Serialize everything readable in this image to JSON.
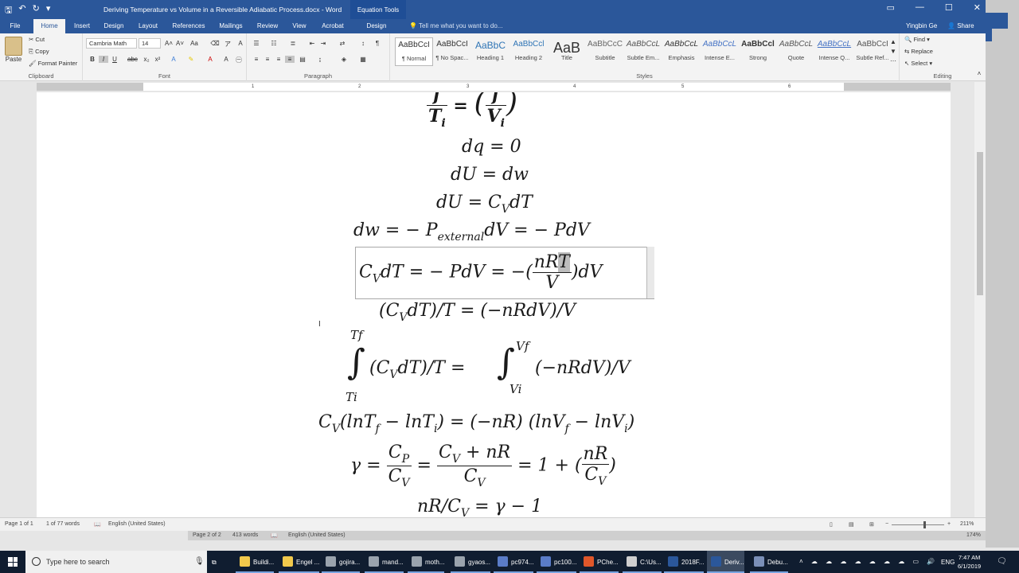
{
  "window": {
    "title": "Deriving Temperature vs Volume in a Reversible Adiabatic Process.docx - Word",
    "context_tab_group": "Equation Tools",
    "user": "Yingbin Ge",
    "share_label": "Share",
    "tell_me_placeholder": "Tell me what you want to do..."
  },
  "tabs": [
    "File",
    "Home",
    "Insert",
    "Design",
    "Layout",
    "References",
    "Mailings",
    "Review",
    "View",
    "Acrobat",
    "Design"
  ],
  "active_tab": "Home",
  "ribbon": {
    "clipboard": {
      "label": "Clipboard",
      "paste": "Paste",
      "cut": "Cut",
      "copy": "Copy",
      "format_painter": "Format Painter"
    },
    "font": {
      "label": "Font",
      "font_name": "Cambria Math",
      "font_size": "14"
    },
    "paragraph": {
      "label": "Paragraph"
    },
    "styles": {
      "label": "Styles",
      "items": [
        {
          "sample": "AaBbCcI",
          "name": "¶ Normal"
        },
        {
          "sample": "AaBbCcI",
          "name": "¶ No Spac..."
        },
        {
          "sample": "AaBbC",
          "name": "Heading 1"
        },
        {
          "sample": "AaBbCcl",
          "name": "Heading 2"
        },
        {
          "sample": "AaB",
          "name": "Title"
        },
        {
          "sample": "AaBbCcC",
          "name": "Subtitle"
        },
        {
          "sample": "AaBbCcL",
          "name": "Subtle Em..."
        },
        {
          "sample": "AaBbCcL",
          "name": "Emphasis"
        },
        {
          "sample": "AaBbCcL",
          "name": "Intense E..."
        },
        {
          "sample": "AaBbCcl",
          "name": "Strong"
        },
        {
          "sample": "AaBbCcL",
          "name": "Quote"
        },
        {
          "sample": "AaBbCcL",
          "name": "Intense Q..."
        },
        {
          "sample": "AaBbCcI",
          "name": "Subtle Ref..."
        }
      ]
    },
    "editing": {
      "label": "Editing",
      "find": "Find",
      "replace": "Replace",
      "select": "Select"
    }
  },
  "ruler_ticks": [
    "1",
    "2",
    "3",
    "4",
    "5",
    "6"
  ],
  "document": {
    "eq1": {
      "left_num": "f",
      "left_den": "T",
      "left_den_sub": "i",
      "eq": "=",
      "right_num": "f",
      "right_den": "V",
      "right_den_sub": "i"
    },
    "eq2": "dq = 0",
    "eq3": "dU  =  dw",
    "eq4": {
      "a": "dU  =  C",
      "sub": "V",
      "b": "dT"
    },
    "eq5": {
      "a": "dw  =  − P",
      "sub": "external",
      "b": "dV  =  − PdV"
    },
    "eq6": {
      "a": "C",
      "sub": "V",
      "b": "dT  =  − PdV = −(",
      "num_a": "nR",
      "num_hl": "T",
      "den": "V",
      "c": ")dV"
    },
    "eq7": {
      "a": "(C",
      "sub": "V",
      "b": "dT)/T  =  (−nRdV)/V"
    },
    "eq8": {
      "upper": "Tf",
      "lower": "Ti",
      "int_sym": "∫",
      "a": "(C",
      "sub": "V",
      "b": "dT)/T  =",
      "upper2": "Vf",
      "lower2": "Vi",
      "c": "(−nRdV)/V"
    },
    "eq9": {
      "a": "C",
      "sub_a": "V",
      "b": "(lnT",
      "sub_b": "f",
      "c": " − lnT",
      "sub_c": "i",
      "d": ")  =  (−nR) (lnV",
      "sub_d": "f",
      "e": " − lnV",
      "sub_e": "i",
      "f": ")"
    },
    "eq10": {
      "gamma": "γ  =",
      "n1": "C",
      "n1s": "P",
      "d1": "C",
      "d1s": "V",
      "mid": "=",
      "n2": "C",
      "n2s": "V",
      "n2b": " + nR",
      "d2": "C",
      "d2s": "V",
      "tail": "=  1  +  (",
      "n3": "nR",
      "d3": "C",
      "d3s": "V",
      "close": ")"
    },
    "eq11": {
      "a": "nR/C",
      "sub": "V",
      "b": "  =  γ  − 1"
    }
  },
  "status": {
    "page": "Page 1 of 1",
    "words": "1 of 77 words",
    "language": "English (United States)",
    "zoom": "211%",
    "page2": "Page 2 of 2",
    "words2": "413 words",
    "language2": "English (United States)",
    "zoom2": "174%"
  },
  "taskbar": {
    "search_placeholder": "Type here to search",
    "apps": [
      {
        "label": "Buildi...",
        "color": "#f2c94c"
      },
      {
        "label": "Engel ...",
        "color": "#f2c94c"
      },
      {
        "label": "gojira...",
        "color": "#9aa3ad"
      },
      {
        "label": "mand...",
        "color": "#9aa3ad"
      },
      {
        "label": "moth...",
        "color": "#9aa3ad"
      },
      {
        "label": "gyaos...",
        "color": "#9aa3ad"
      },
      {
        "label": "pc974...",
        "color": "#5a7cc8"
      },
      {
        "label": "pc100...",
        "color": "#5a7cc8"
      },
      {
        "label": "PChe...",
        "color": "#e0572a"
      },
      {
        "label": "C:\\Us...",
        "color": "#cfcfcf"
      },
      {
        "label": "2018F...",
        "color": "#2b579a"
      },
      {
        "label": "Deriv...",
        "color": "#2b579a"
      },
      {
        "label": "Debu...",
        "color": "#7a8fb8"
      }
    ],
    "language": "ENG",
    "time": "7:47 AM",
    "date": "6/1/2019"
  }
}
